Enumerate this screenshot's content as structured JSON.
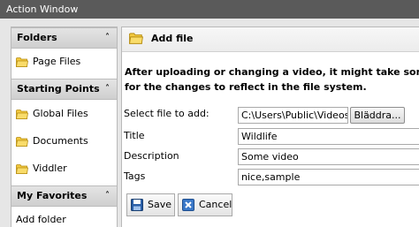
{
  "window": {
    "title": "Action Window"
  },
  "sidebar": {
    "sections": [
      {
        "title": "Folders",
        "chevron": "chevron-up-icon",
        "items": [
          "Page Files"
        ]
      },
      {
        "title": "Starting Points",
        "chevron": "chevron-up-icon",
        "items": [
          "Global Files",
          "Documents",
          "Viddler"
        ]
      },
      {
        "title": "My Favorites",
        "chevron": "chevron-up-icon",
        "items": [
          "Add folder"
        ]
      }
    ]
  },
  "panel": {
    "title": "Add file",
    "notice_line1": "After uploading or changing a video, it might take some tim",
    "notice_line2": "for the changes to reflect in the file system.",
    "form": {
      "file_label": "Select file to add:",
      "file_value": "C:\\Users\\Public\\Videos\\",
      "browse_label": "Bläddra...",
      "title_label": "Title",
      "title_value": "Wildlife",
      "description_label": "Description",
      "description_value": "Some video",
      "tags_label": "Tags",
      "tags_value": "nice,sample"
    },
    "buttons": {
      "save": "Save",
      "cancel": "Cancel"
    }
  },
  "colors": {
    "titlebar": "#5a5a5a",
    "folder_yellow": "#f3c93f",
    "save_blue": "#2a5fa8",
    "cancel_blue": "#3a78c8"
  }
}
